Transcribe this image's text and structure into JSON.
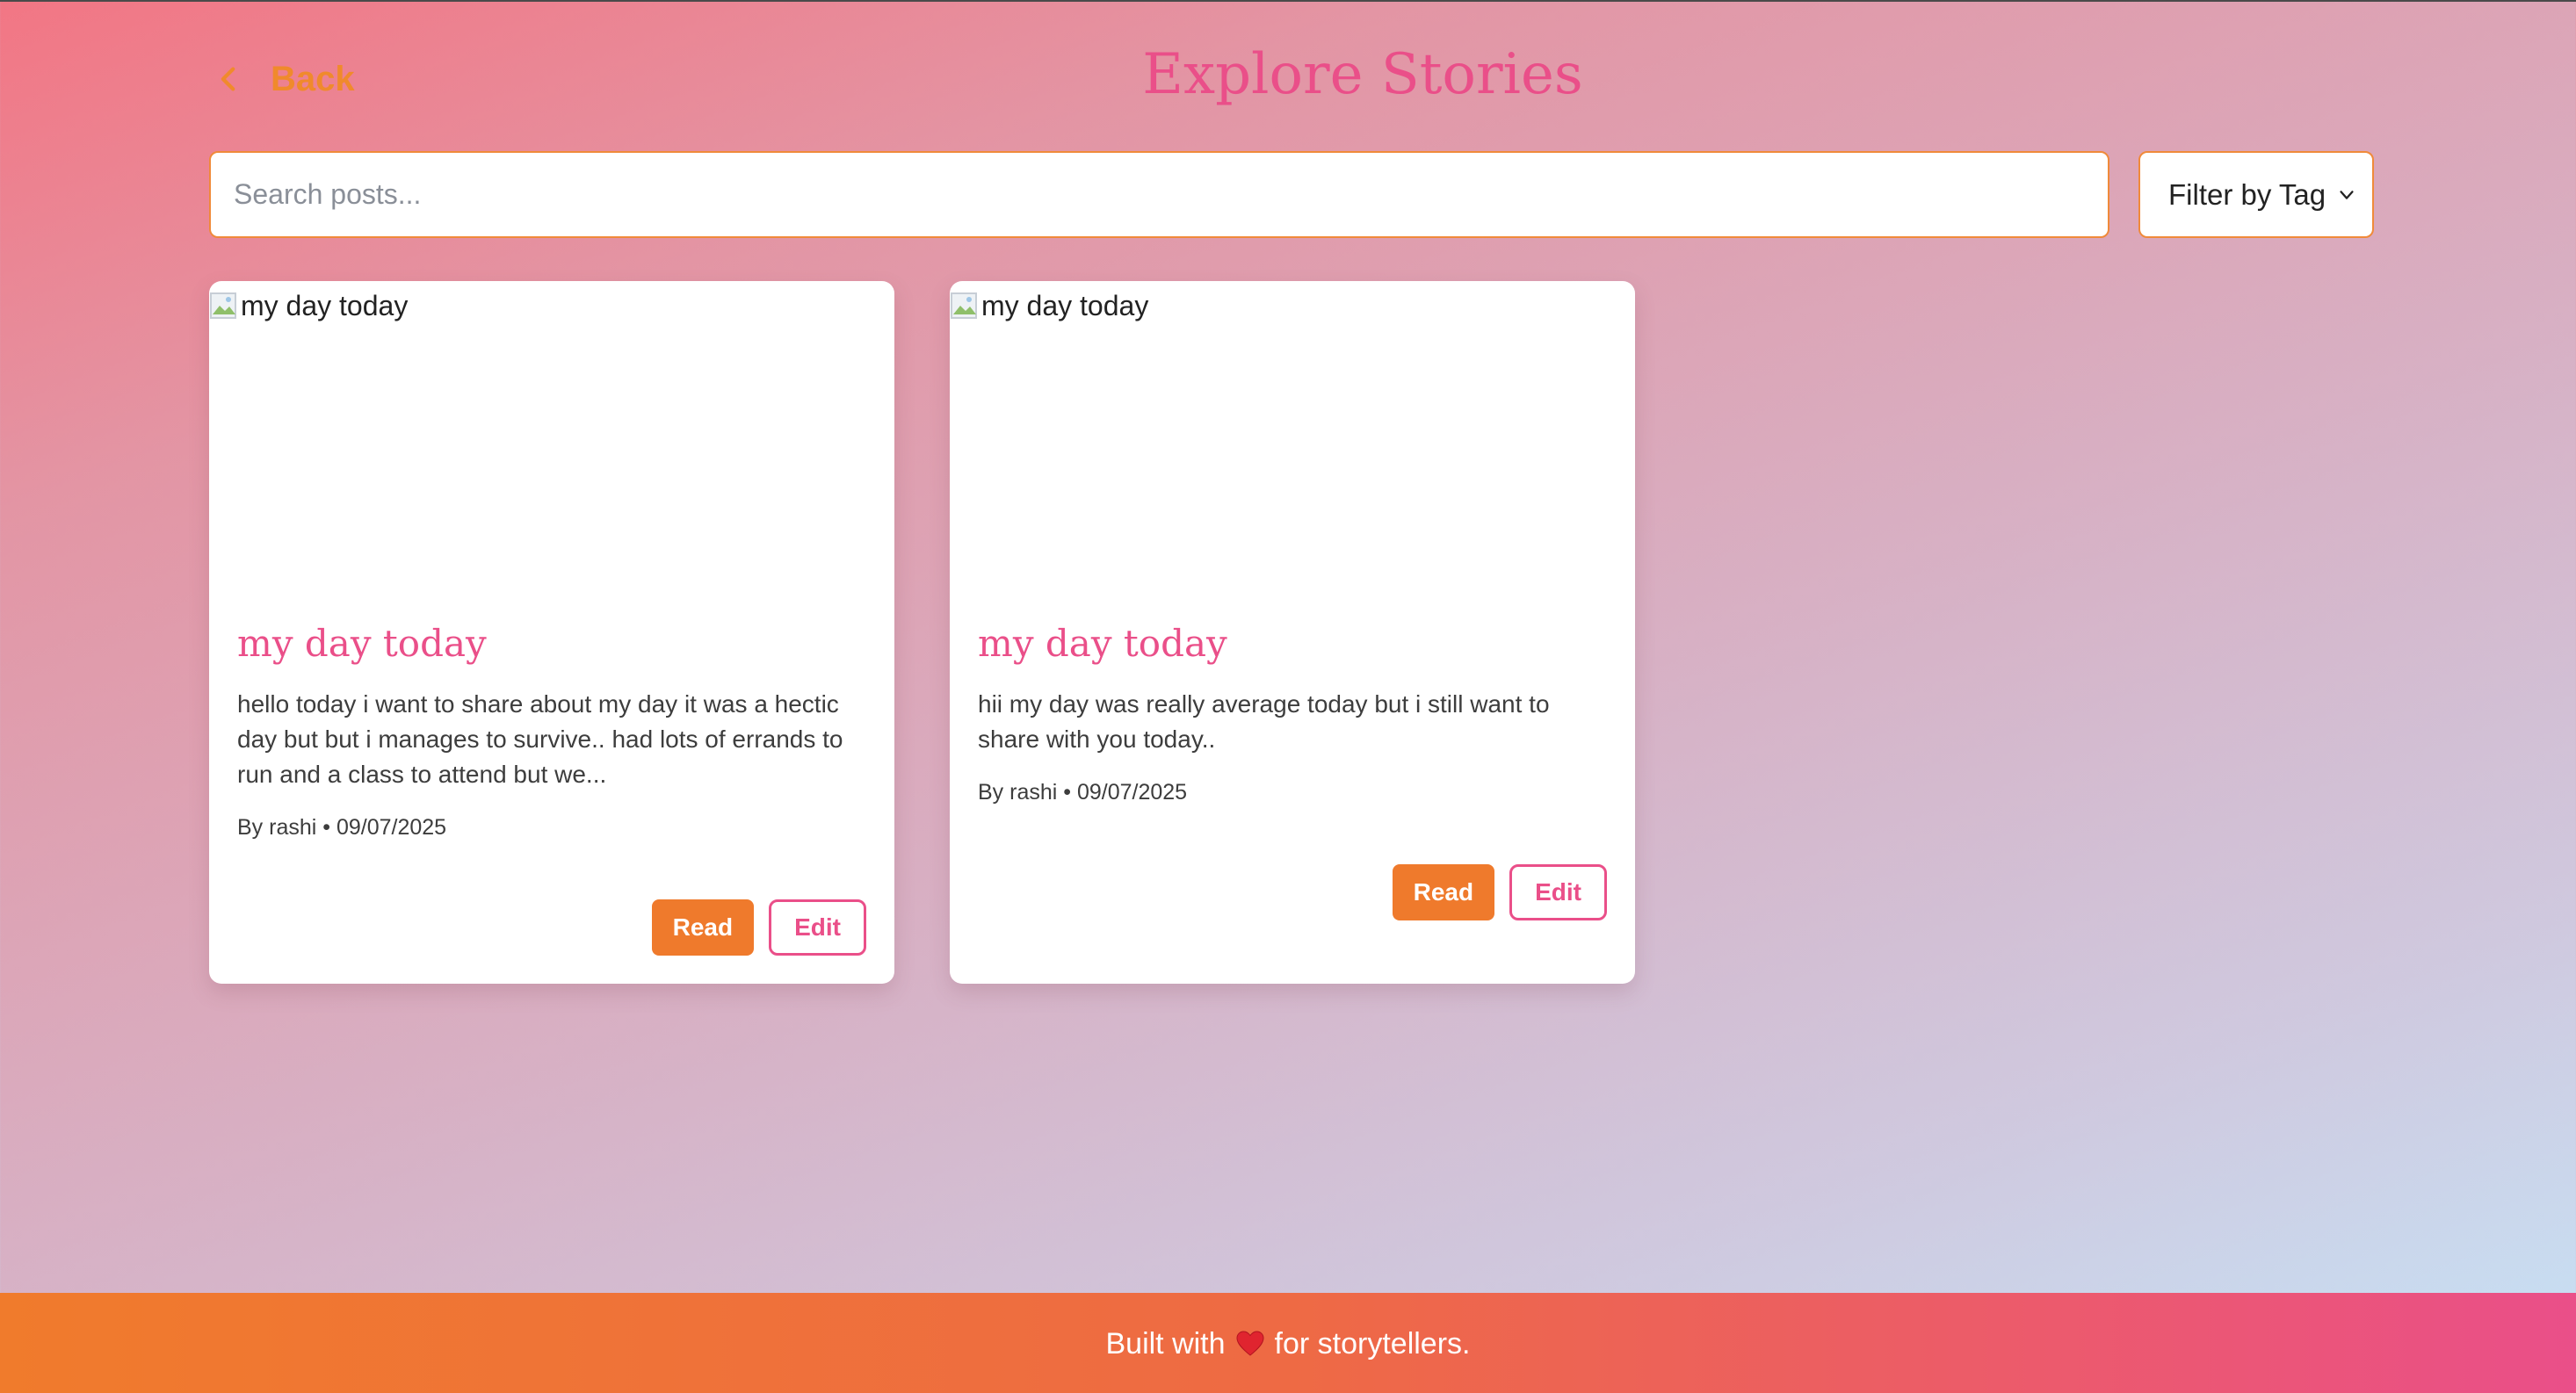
{
  "header": {
    "back_label": "Back",
    "title": "Explore Stories"
  },
  "search": {
    "placeholder": "Search posts...",
    "value": ""
  },
  "filter": {
    "selected": "Filter by Tag"
  },
  "posts": [
    {
      "image_alt": "my day today",
      "title": "my day today",
      "excerpt": "hello today i want to share about my day it was a hectic day but but i manages to survive.. had lots of errands to run and a class to attend but we...",
      "meta": "By rashi • 09/07/2025",
      "read_label": "Read",
      "edit_label": "Edit"
    },
    {
      "image_alt": "my day today",
      "title": "my day today",
      "excerpt": "hii my day was really average today but i still want to share with you today..",
      "meta": "By rashi • 09/07/2025",
      "read_label": "Read",
      "edit_label": "Edit"
    }
  ],
  "footer": {
    "text_before": "Built with",
    "text_after": "for storytellers."
  },
  "colors": {
    "accent_orange": "#ef7a2c",
    "accent_pink": "#ea4f89"
  }
}
